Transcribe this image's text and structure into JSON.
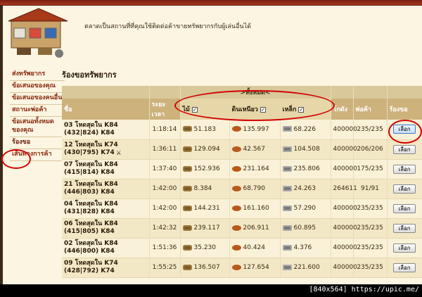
{
  "header": {
    "description": "ตลาดเป็นสถานที่ที่คุณใช้ติดต่อค้าขายทรัพยากรกับผู้เล่นอื่นได้"
  },
  "sidebar": {
    "items": [
      {
        "label": "ส่งทรัพยากร"
      },
      {
        "label": "ข้อเสนอของคุณ"
      },
      {
        "label": "ข้อเสนอของคนอื่น"
      },
      {
        "label": "สถานะพ่อค้า"
      },
      {
        "label": "ข้อเสนอทั้งหมดของคุณ"
      },
      {
        "label": "ร้องขอ"
      },
      {
        "label": "เส้นทางการค้า"
      }
    ]
  },
  "main": {
    "title": "ร้องขอทรัพยากร",
    "all_label": ">ทั้งหมด<",
    "columns": {
      "name": "ชื่อ",
      "time": "ระยะเวลา",
      "wood": "ไม้",
      "clay": "ดินเหนียว",
      "iron": "เหล็ก",
      "warehouse": "โกดัง",
      "merchants": "พ่อค้า",
      "request": "ร้องขอ"
    },
    "select_label": "เลือก",
    "rows": [
      {
        "name": "03 โหดสุดใน K84 (432|824) K84",
        "time": "1:18:14",
        "wood": "51.183",
        "clay": "135.997",
        "iron": "68.226",
        "warehouse": "400000",
        "merchants": "235/235"
      },
      {
        "name": "12 โหดสุดใน K74 (430|795) K74",
        "time": "1:36:11",
        "wood": "129.094",
        "clay": "42.567",
        "iron": "104.508",
        "warehouse": "400000",
        "merchants": "206/206"
      },
      {
        "name": "07 โหดสุดใน K84 (415|814) K84",
        "time": "1:37:40",
        "wood": "152.936",
        "clay": "231.164",
        "iron": "235.806",
        "warehouse": "400000",
        "merchants": "175/235"
      },
      {
        "name": "21 โหดสุดใน K84 (446|803) K84",
        "time": "1:42:00",
        "wood": "8.384",
        "clay": "68.790",
        "iron": "24.263",
        "warehouse": "264611",
        "merchants": "91/91"
      },
      {
        "name": "04 โหดสุดใน K84 (431|828) K84",
        "time": "1:42:00",
        "wood": "144.231",
        "clay": "161.160",
        "iron": "57.290",
        "warehouse": "400000",
        "merchants": "235/235"
      },
      {
        "name": "06 โหดสุดใน K84 (415|805) K84",
        "time": "1:42:32",
        "wood": "239.117",
        "clay": "206.911",
        "iron": "60.895",
        "warehouse": "400000",
        "merchants": "235/235"
      },
      {
        "name": "02 โหดสุดใน K84 (446|800) K84",
        "time": "1:51:36",
        "wood": "35.230",
        "clay": "40.424",
        "iron": "4.376",
        "warehouse": "400000",
        "merchants": "235/235"
      },
      {
        "name": "09 โหดสุดใน K74 (428|792) K74",
        "time": "1:55:25",
        "wood": "136.507",
        "clay": "127.654",
        "iron": "221.600",
        "warehouse": "400000",
        "merchants": "235/235"
      }
    ]
  },
  "footer": {
    "watermark": "[840x564] https://upic.me/"
  },
  "colors": {
    "accent_red": "#d40000",
    "header_bg": "#cdb27c",
    "link": "#8a2a10"
  }
}
